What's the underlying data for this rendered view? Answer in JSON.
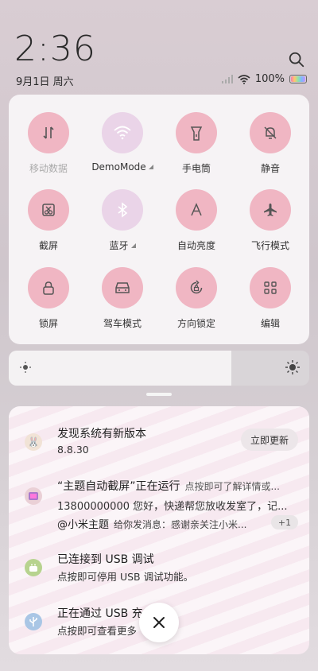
{
  "status_bar": {
    "time": "2:36",
    "date": "9月1日 周六",
    "battery": "100%",
    "battery_level": 1.0
  },
  "quick_settings": {
    "tiles": [
      {
        "label": "移动数据",
        "icon": "mobile-data-icon",
        "active": false
      },
      {
        "label": "DemoMode",
        "icon": "wifi-icon",
        "active": true
      },
      {
        "label": "手电筒",
        "icon": "flashlight-icon",
        "active": false
      },
      {
        "label": "静音",
        "icon": "mute-icon",
        "active": false
      },
      {
        "label": "截屏",
        "icon": "screenshot-icon",
        "active": false
      },
      {
        "label": "蓝牙",
        "icon": "bluetooth-icon",
        "active": true
      },
      {
        "label": "自动亮度",
        "icon": "auto-brightness-icon",
        "active": false
      },
      {
        "label": "飞行模式",
        "icon": "airplane-icon",
        "active": false
      },
      {
        "label": "锁屏",
        "icon": "lock-icon",
        "active": false
      },
      {
        "label": "驾车模式",
        "icon": "car-icon",
        "active": false
      },
      {
        "label": "方向锁定",
        "icon": "rotation-lock-icon",
        "active": false
      },
      {
        "label": "编辑",
        "icon": "grid-icon",
        "active": false
      }
    ]
  },
  "brightness": {
    "level": 0.74
  },
  "notifications": [
    {
      "title": "发现系统有新版本",
      "text": "8.8.30",
      "action": "立即更新"
    },
    {
      "title": "“主题自动截屏”正在运行",
      "subtitle": "点按即可了解详情或...",
      "text": "13800000000 您好，快递帮您放收发室了，记...",
      "line3_title": "@小米主题",
      "line3_text": "给你发消息：感谢亲关注小米...",
      "badge": "+1"
    },
    {
      "title": "已连接到 USB 调试",
      "text": "点按即可停用 USB 调试功能。"
    },
    {
      "title": "正在通过 USB 充",
      "text": "点按即可查看更多"
    }
  ],
  "colors": {
    "tile_active_pink": "#f0b6c3",
    "tile_lilac": "#ead4e8"
  }
}
